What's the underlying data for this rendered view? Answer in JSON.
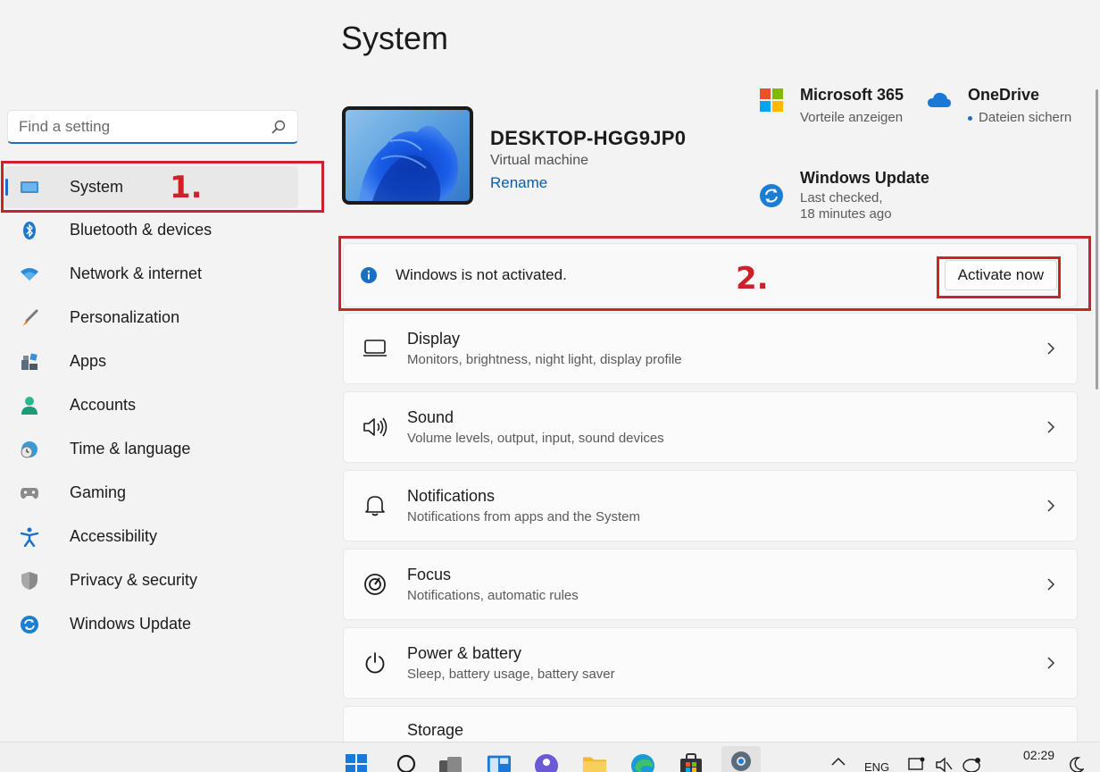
{
  "page": {
    "title": "System"
  },
  "search": {
    "placeholder": "Find a setting"
  },
  "sidebar": {
    "items": [
      {
        "label": "System",
        "icon": "monitor-icon",
        "active": true
      },
      {
        "label": "Bluetooth & devices",
        "icon": "bluetooth-icon"
      },
      {
        "label": "Network & internet",
        "icon": "wifi-icon"
      },
      {
        "label": "Personalization",
        "icon": "brush-icon"
      },
      {
        "label": "Apps",
        "icon": "apps-icon"
      },
      {
        "label": "Accounts",
        "icon": "person-icon"
      },
      {
        "label": "Time & language",
        "icon": "globe-clock-icon"
      },
      {
        "label": "Gaming",
        "icon": "gamepad-icon"
      },
      {
        "label": "Accessibility",
        "icon": "accessibility-icon"
      },
      {
        "label": "Privacy & security",
        "icon": "shield-icon"
      },
      {
        "label": "Windows Update",
        "icon": "update-icon"
      }
    ]
  },
  "device": {
    "name": "DESKTOP-HGG9JP0",
    "type": "Virtual machine",
    "rename_label": "Rename"
  },
  "services": {
    "m365": {
      "title": "Microsoft 365",
      "subtitle": "Vorteile anzeigen",
      "icon": "microsoft-logo-icon"
    },
    "onedrive": {
      "title": "OneDrive",
      "subtitle": "Dateien sichern",
      "icon": "cloud-icon"
    },
    "update": {
      "title": "Windows Update",
      "subtitle_line1": "Last checked,",
      "subtitle_line2": "18 minutes ago",
      "icon": "update-icon"
    }
  },
  "activation": {
    "message": "Windows is not activated.",
    "button_label": "Activate now"
  },
  "annotations": {
    "one": "1.",
    "two": "2."
  },
  "cards": [
    {
      "title": "Display",
      "subtitle": "Monitors, brightness, night light, display profile",
      "icon": "display-icon"
    },
    {
      "title": "Sound",
      "subtitle": "Volume levels, output, input, sound devices",
      "icon": "speaker-icon"
    },
    {
      "title": "Notifications",
      "subtitle": "Notifications from apps and the System",
      "icon": "bell-icon"
    },
    {
      "title": "Focus",
      "subtitle": "Notifications, automatic rules",
      "icon": "focus-icon"
    },
    {
      "title": "Power & battery",
      "subtitle": "Sleep, battery usage, battery saver",
      "icon": "power-icon"
    },
    {
      "title": "Storage",
      "subtitle": "",
      "icon": "storage-icon"
    }
  ],
  "taskbar": {
    "language": "ENG",
    "time": "02:29"
  },
  "colors": {
    "accent": "#1a6fc4",
    "annotation_red": "#cc2229",
    "background": "#f3f3f3"
  }
}
